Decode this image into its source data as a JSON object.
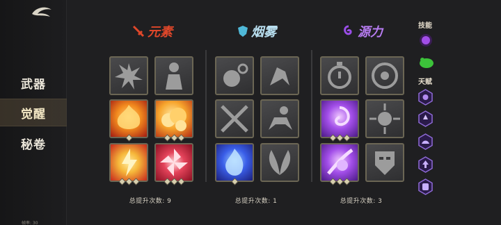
{
  "sidebar": {
    "logo_icon": "dragon-logo-icon",
    "items": [
      {
        "label": "武器",
        "active": false
      },
      {
        "label": "觉醒",
        "active": true
      },
      {
        "label": "秘卷",
        "active": false
      }
    ],
    "fps_label": "帧率: 30"
  },
  "groups": [
    {
      "name": "元素",
      "icon": "sword-icon",
      "color": "#e0472a",
      "total_label": "总提升次数: 9",
      "tiles": [
        {
          "style": "dim",
          "icon": "explosion-icon",
          "gems": 0
        },
        {
          "style": "dim",
          "icon": "warrior-icon",
          "gems": 0
        },
        {
          "style": "fire",
          "icon": "flame-burst-icon",
          "gems": 1
        },
        {
          "style": "fire2",
          "icon": "fire-cloud-icon",
          "gems": 3
        },
        {
          "style": "fire3",
          "icon": "lightning-icon",
          "gems": 3
        },
        {
          "style": "fire4",
          "icon": "pinwheel-icon",
          "gems": 3
        }
      ]
    },
    {
      "name": "烟雾",
      "icon": "shield-icon",
      "color": "#4fb8d8",
      "total_label": "总提升次数: 1",
      "tiles": [
        {
          "style": "dim",
          "icon": "bomb-icon",
          "gems": 0
        },
        {
          "style": "dim",
          "icon": "dash-figure-icon",
          "gems": 0
        },
        {
          "style": "dim",
          "icon": "cross-arrows-icon",
          "gems": 0
        },
        {
          "style": "dim",
          "icon": "crouch-figure-icon",
          "gems": 0
        },
        {
          "style": "blue",
          "icon": "spirit-flame-icon",
          "gems": 1
        },
        {
          "style": "dim",
          "icon": "leaves-icon",
          "gems": 0
        }
      ]
    },
    {
      "name": "源力",
      "icon": "swirl-icon",
      "color": "#9a4ee8",
      "total_label": "总提升次数: 3",
      "tiles": [
        {
          "style": "dim",
          "icon": "timer-icon",
          "gems": 0
        },
        {
          "style": "dim",
          "icon": "vortex-icon",
          "gems": 0
        },
        {
          "style": "purple",
          "icon": "purple-vortex-icon",
          "gems": 3
        },
        {
          "style": "dim",
          "icon": "shatter-icon",
          "gems": 0
        },
        {
          "style": "purple",
          "icon": "purple-slash-icon",
          "gems": 3
        },
        {
          "style": "dim",
          "icon": "mask-icon",
          "gems": 0
        }
      ]
    }
  ],
  "right_panel": {
    "skills_label": "技能",
    "talents_label": "天赋",
    "skills": [
      {
        "icon": "purple-orb-icon",
        "color": "#a24ee8"
      },
      {
        "icon": "green-creature-icon",
        "color": "#3cc23a"
      }
    ],
    "talents": [
      {
        "icon": "talent-gem-icon"
      },
      {
        "icon": "talent-arrow-icon"
      },
      {
        "icon": "talent-wave-icon"
      },
      {
        "icon": "talent-up-icon"
      },
      {
        "icon": "talent-shield-icon"
      }
    ]
  }
}
